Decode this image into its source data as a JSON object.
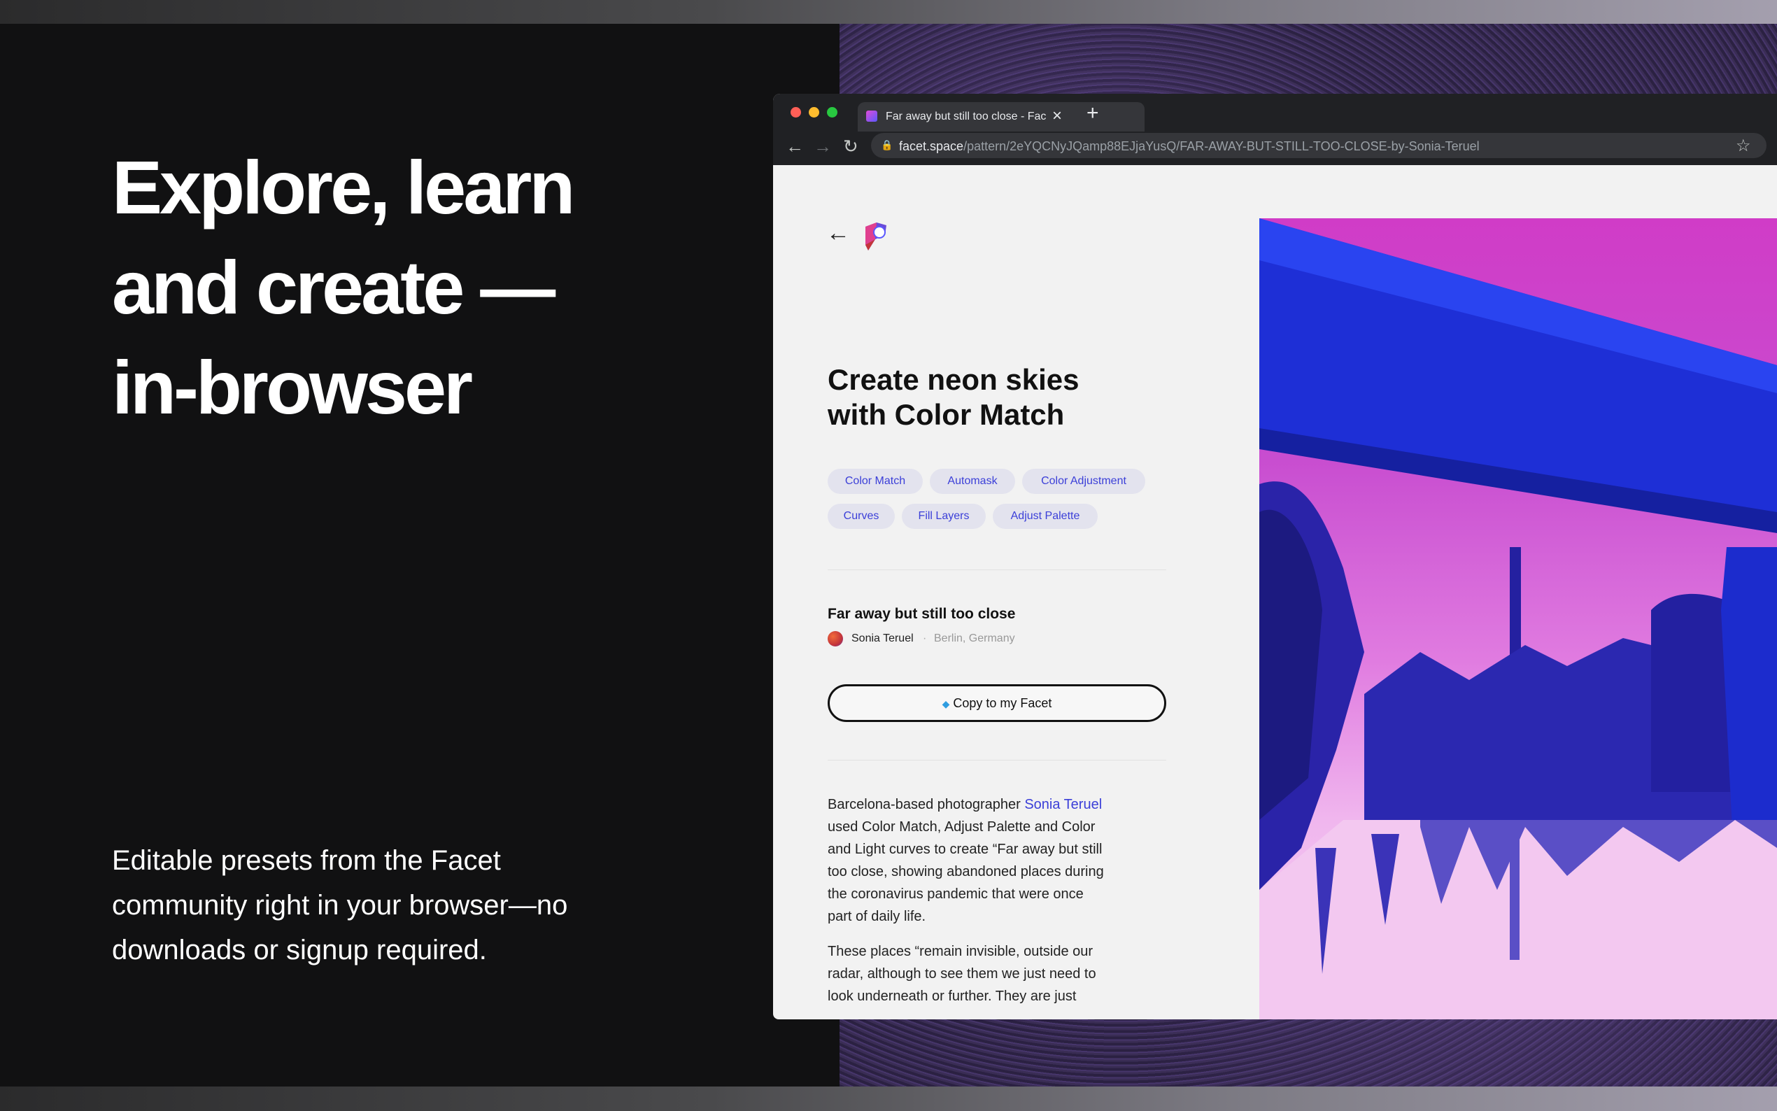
{
  "hero": {
    "lines": [
      "Explore, learn",
      "and create  —",
      "in-browser"
    ],
    "subtitle_lines": [
      "Editable presets from the Facet",
      "community right in your browser—no",
      "downloads or signup required."
    ]
  },
  "browser": {
    "tab_title": "Far away but still too close - Fac",
    "url_host": "facet.space",
    "url_path": "/pattern/2eYQCNyJQamp88EJjaYusQ/FAR-AWAY-BUT-STILL-TOO-CLOSE-by-Sonia-Teruel"
  },
  "page": {
    "title_lines": [
      "Create neon skies",
      "with Color Match"
    ],
    "tags": [
      "Color Match",
      "Automask",
      "Color Adjustment",
      "Curves",
      "Fill Layers",
      "Adjust Palette"
    ],
    "pattern_title": "Far away but still too close",
    "author": "Sonia Teruel",
    "separator": "·",
    "location": "Berlin, Germany",
    "copy_button": "Copy to my Facet",
    "paragraph1": {
      "prefix": "Barcelona-based photographer ",
      "link": "Sonia Teruel",
      "lines": [
        "used Color Match, Adjust Palette and Color",
        "and Light curves to create “Far away but still",
        "too close, showing abandoned places during",
        "the coronavirus pandemic that were once",
        "part of daily life."
      ]
    },
    "paragraph2_lines": [
      "These places “remain invisible, outside our",
      "radar, although to see them we just need to",
      "look underneath or further. They are just"
    ]
  },
  "colors": {
    "accent": "#3b3fd8",
    "chip_bg": "#e3e3ee",
    "photo_magenta": "#d03cc7",
    "photo_blue": "#2a2fd9"
  }
}
